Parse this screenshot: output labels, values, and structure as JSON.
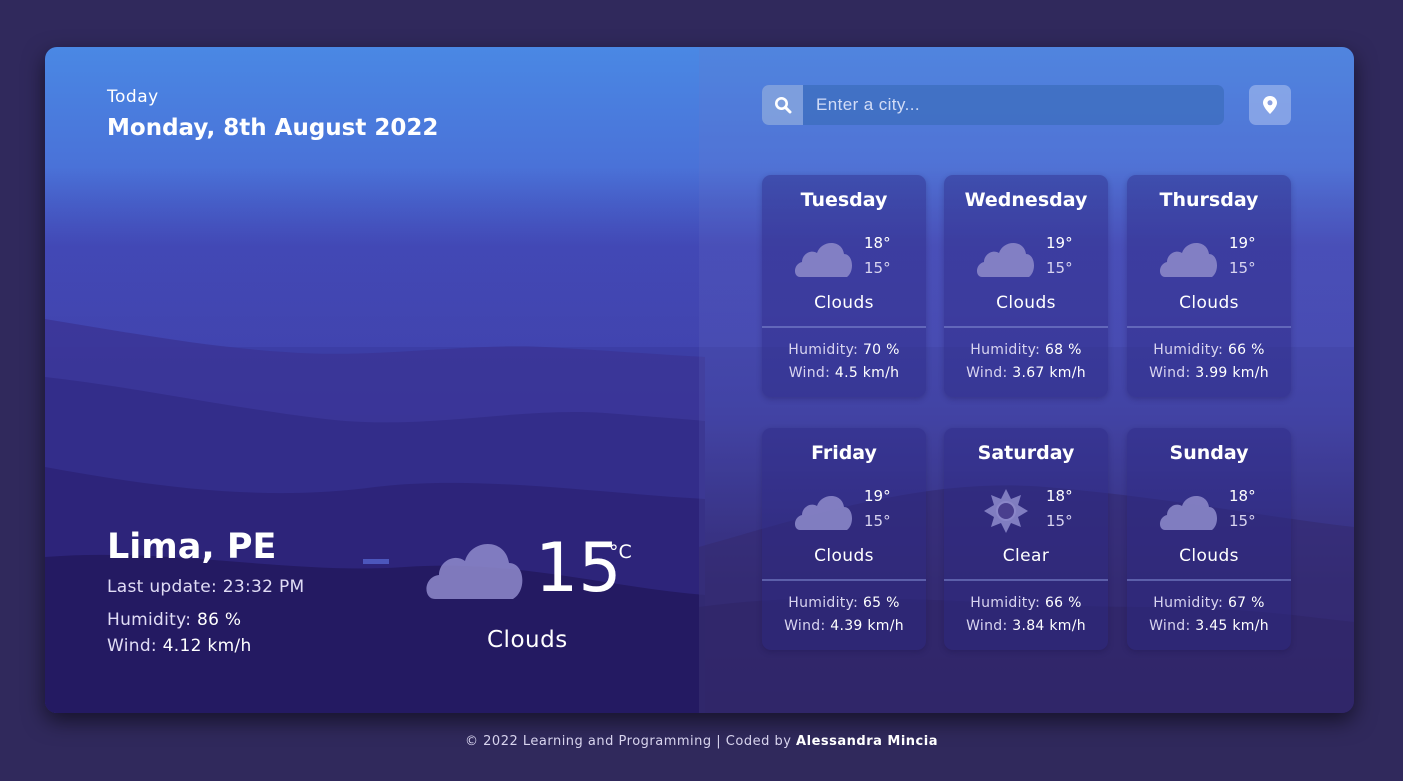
{
  "current": {
    "today_label": "Today",
    "date": "Monday, 8th August 2022",
    "city": "Lima, PE",
    "last_update_label": "Last update: 23:32 PM",
    "humidity_label": "Humidity:",
    "humidity_value": "86 %",
    "wind_label": "Wind:",
    "wind_value": "4.12 km/h",
    "temperature": "15",
    "unit": "°C",
    "condition": "Clouds",
    "icon": "cloud-icon"
  },
  "search": {
    "placeholder": "Enter a city...",
    "search_icon": "search-icon",
    "location_icon": "location-pin-icon"
  },
  "forecast": [
    {
      "day": "Tuesday",
      "max": "18°",
      "min": "15°",
      "condition": "Clouds",
      "icon": "cloud-icon",
      "humidity_label": "Humidity:",
      "humidity": "70 %",
      "wind_label": "Wind:",
      "wind": "4.5 km/h"
    },
    {
      "day": "Wednesday",
      "max": "19°",
      "min": "15°",
      "condition": "Clouds",
      "icon": "cloud-icon",
      "humidity_label": "Humidity:",
      "humidity": "68 %",
      "wind_label": "Wind:",
      "wind": "3.67 km/h"
    },
    {
      "day": "Thursday",
      "max": "19°",
      "min": "15°",
      "condition": "Clouds",
      "icon": "cloud-icon",
      "humidity_label": "Humidity:",
      "humidity": "66 %",
      "wind_label": "Wind:",
      "wind": "3.99 km/h"
    },
    {
      "day": "Friday",
      "max": "19°",
      "min": "15°",
      "condition": "Clouds",
      "icon": "cloud-icon",
      "humidity_label": "Humidity:",
      "humidity": "65 %",
      "wind_label": "Wind:",
      "wind": "4.39 km/h"
    },
    {
      "day": "Saturday",
      "max": "18°",
      "min": "15°",
      "condition": "Clear",
      "icon": "sun-icon",
      "humidity_label": "Humidity:",
      "humidity": "66 %",
      "wind_label": "Wind:",
      "wind": "3.84 km/h"
    },
    {
      "day": "Sunday",
      "max": "18°",
      "min": "15°",
      "condition": "Clouds",
      "icon": "cloud-icon",
      "humidity_label": "Humidity:",
      "humidity": "67 %",
      "wind_label": "Wind:",
      "wind": "3.45 km/h"
    }
  ],
  "footer": {
    "text": "© 2022 Learning and Programming | Coded by",
    "author": "Alessandra Mincia"
  },
  "colors": {
    "page_background": "#30295c",
    "sky_top": "#4a88e4",
    "mountain": "#2a1f6a",
    "cloud_icon": "#8a86c8"
  }
}
